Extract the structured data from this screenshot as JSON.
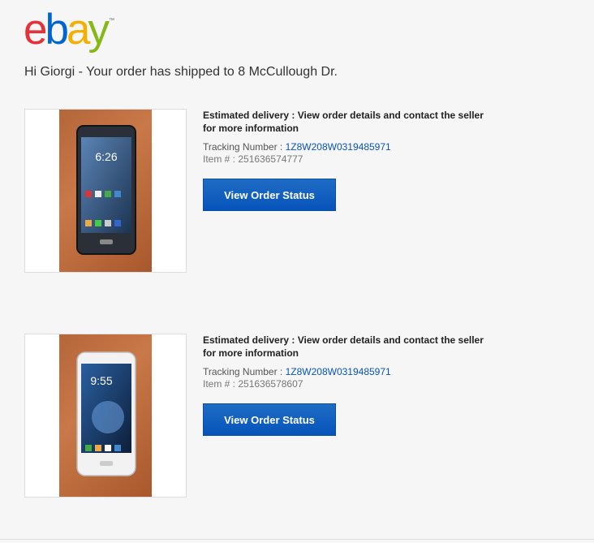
{
  "brand": {
    "logo_letters": [
      "e",
      "b",
      "a",
      "y"
    ],
    "logo_colors": [
      "#e53238",
      "#0064d2",
      "#f5af02",
      "#86b817"
    ],
    "trademark": "™"
  },
  "greeting": "Hi Giorgi - Your order has shipped to 8 McCullough Dr.",
  "orders": [
    {
      "estimated_delivery": "Estimated delivery : View order details and contact the seller for more information",
      "tracking_label": "Tracking Number : ",
      "tracking_number": "1Z8W208W0319485971",
      "item_label": "Item # : ",
      "item_number": "251636574777",
      "button_label": "View Order Status",
      "phone_time": "6:26",
      "phone_color": "dark"
    },
    {
      "estimated_delivery": "Estimated delivery : View order details and contact the seller for more information",
      "tracking_label": "Tracking Number : ",
      "tracking_number": "1Z8W208W0319485971",
      "item_label": "Item # : ",
      "item_number": "251636578607",
      "button_label": "View Order Status",
      "phone_time": "9:55",
      "phone_color": "white"
    }
  ]
}
